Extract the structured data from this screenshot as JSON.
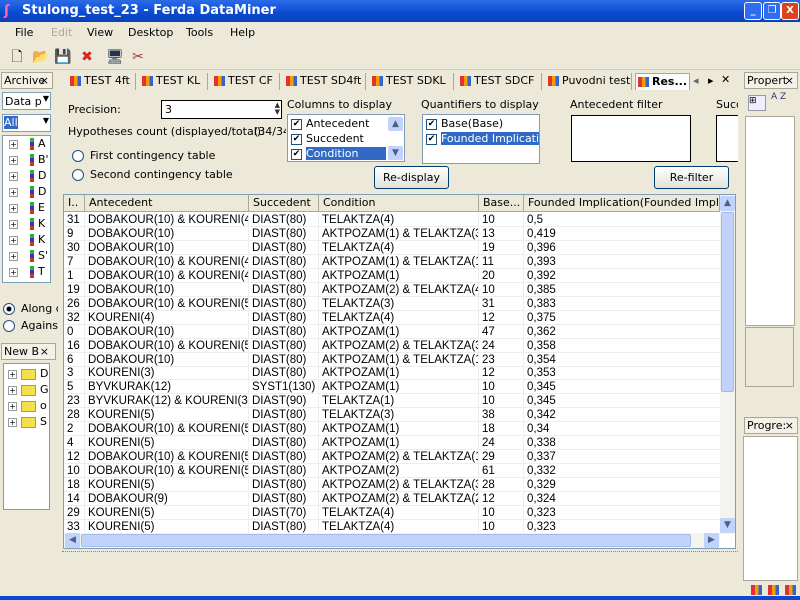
{
  "window": {
    "title": "Stulong_test_23 - Ferda DataMiner",
    "min": "_",
    "max": "❐",
    "close": "X"
  },
  "menu": [
    "File",
    "Edit",
    "View",
    "Desktop",
    "Tools",
    "Help"
  ],
  "toolbar": {
    "new": "🗋",
    "open": "📂",
    "save": "💾",
    "delete": "✖",
    "monitor": "🖥",
    "tools": "✂"
  },
  "left": {
    "archive_title": "Archive",
    "close": "×",
    "data_select": "Data p",
    "filter_select": "All",
    "tree_items": [
      "A",
      "B'",
      "D",
      "D",
      "E",
      "K",
      "K",
      "S'",
      "T"
    ],
    "radio_along": "Along c",
    "radio_against": "Against",
    "newbox_title": "New B",
    "folders": [
      "D",
      "G",
      "o",
      "S"
    ]
  },
  "tabs": [
    "TEST 4ft",
    "TEST KL",
    "TEST CF",
    "TEST SD4ft",
    "TEST SDKL",
    "TEST SDCF",
    "Puvodni test",
    "Res..."
  ],
  "tab_active": 7,
  "controls": {
    "precision_label": "Precision:",
    "precision_value": "3",
    "hyp_label": "Hypotheses count (displayed/total):",
    "hyp_value": "(34/34",
    "radio_first": "First contingency table",
    "radio_second": "Second contingency table",
    "columns_label": "Columns to display",
    "columns": [
      "Antecedent",
      "Succedent",
      "Condition"
    ],
    "quantifiers_label": "Quantifiers to display",
    "quantifiers": [
      "Base(Base)",
      "Founded  Implication"
    ],
    "antecedent_filter_label": "Antecedent filter",
    "succedent_filter_label": "Succ",
    "redisplay": "Re-display",
    "refilter": "Re-filter"
  },
  "grid": {
    "headers": [
      "I..",
      "Antecedent",
      "Succedent",
      "Condition",
      "Base...",
      "Founded Implication(Founded Implicat..."
    ],
    "rows": [
      [
        "31",
        "DOBAKOUR(10) & KOURENI(4)",
        "DIAST(80)",
        "TELAKTZA(4)",
        "10",
        "0,5"
      ],
      [
        "9",
        "DOBAKOUR(10)",
        "DIAST(80)",
        "AKTPOZAM(1) & TELAKTZA(3)",
        "13",
        "0,419"
      ],
      [
        "30",
        "DOBAKOUR(10)",
        "DIAST(80)",
        "TELAKTZA(4)",
        "19",
        "0,396"
      ],
      [
        "7",
        "DOBAKOUR(10) & KOURENI(4)",
        "DIAST(80)",
        "AKTPOZAM(1) & TELAKTZA(1)",
        "11",
        "0,393"
      ],
      [
        "1",
        "DOBAKOUR(10) & KOURENI(4)",
        "DIAST(80)",
        "AKTPOZAM(1)",
        "20",
        "0,392"
      ],
      [
        "19",
        "DOBAKOUR(10)",
        "DIAST(80)",
        "AKTPOZAM(2) & TELAKTZA(4)",
        "10",
        "0,385"
      ],
      [
        "26",
        "DOBAKOUR(10) & KOURENI(5)",
        "DIAST(80)",
        "TELAKTZA(3)",
        "31",
        "0,383"
      ],
      [
        "32",
        "KOURENI(4)",
        "DIAST(80)",
        "TELAKTZA(4)",
        "12",
        "0,375"
      ],
      [
        "0",
        "DOBAKOUR(10)",
        "DIAST(80)",
        "AKTPOZAM(1)",
        "47",
        "0,362"
      ],
      [
        "16",
        "DOBAKOUR(10) & KOURENI(5)",
        "DIAST(80)",
        "AKTPOZAM(2) & TELAKTZA(3)",
        "24",
        "0,358"
      ],
      [
        "6",
        "DOBAKOUR(10)",
        "DIAST(80)",
        "AKTPOZAM(1) & TELAKTZA(1)",
        "23",
        "0,354"
      ],
      [
        "3",
        "KOURENI(3)",
        "DIAST(80)",
        "AKTPOZAM(1)",
        "12",
        "0,353"
      ],
      [
        "5",
        "BYVKURAK(12)",
        "SYST1(130)",
        "AKTPOZAM(1)",
        "10",
        "0,345"
      ],
      [
        "23",
        "BYVKURAK(12) & KOURENI(3)",
        "DIAST(90)",
        "TELAKTZA(1)",
        "10",
        "0,345"
      ],
      [
        "28",
        "KOURENI(5)",
        "DIAST(80)",
        "TELAKTZA(3)",
        "38",
        "0,342"
      ],
      [
        "2",
        "DOBAKOUR(10) & KOURENI(5)",
        "DIAST(80)",
        "AKTPOZAM(1)",
        "18",
        "0,34"
      ],
      [
        "4",
        "KOURENI(5)",
        "DIAST(80)",
        "AKTPOZAM(1)",
        "24",
        "0,338"
      ],
      [
        "12",
        "DOBAKOUR(10) & KOURENI(5)",
        "DIAST(80)",
        "AKTPOZAM(2) & TELAKTZA(1)",
        "29",
        "0,337"
      ],
      [
        "10",
        "DOBAKOUR(10) & KOURENI(5)",
        "DIAST(80)",
        "AKTPOZAM(2)",
        "61",
        "0,332"
      ],
      [
        "18",
        "KOURENI(5)",
        "DIAST(80)",
        "AKTPOZAM(2) & TELAKTZA(3)",
        "28",
        "0,329"
      ],
      [
        "14",
        "DOBAKOUR(9)",
        "DIAST(80)",
        "AKTPOZAM(2) & TELAKTZA(2)",
        "12",
        "0,324"
      ],
      [
        "29",
        "KOURENI(5)",
        "DIAST(70)",
        "TELAKTZA(4)",
        "10",
        "0,323"
      ],
      [
        "33",
        "KOURENI(5)",
        "DIAST(80)",
        "TELAKTZA(4)",
        "10",
        "0,323"
      ]
    ]
  },
  "right": {
    "properties_title": "Propert",
    "progress_title": "Progre:",
    "close": "×",
    "sort_az": "A Z"
  },
  "colors": {
    "titlebar": "#0a49d0",
    "selection": "#316ac5",
    "scroll": "#c1d3fb"
  }
}
